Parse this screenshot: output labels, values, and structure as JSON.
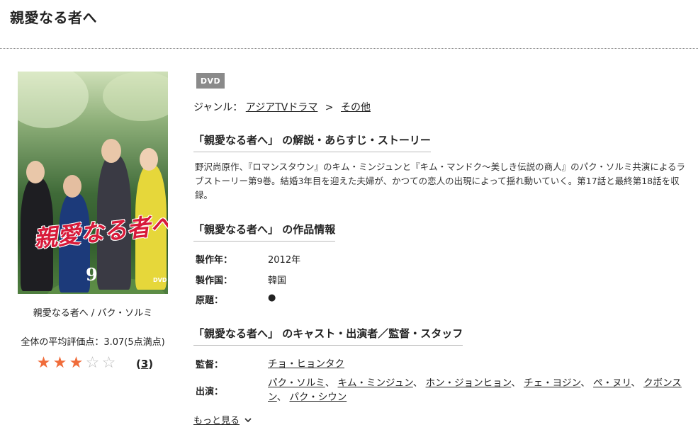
{
  "page": {
    "title": "親愛なる者へ"
  },
  "cover": {
    "logo_text": "親愛なる者へ",
    "volume": "9",
    "dvd_mark": "DVD"
  },
  "caption": "親愛なる者へ / パク・ソルミ",
  "rating": {
    "text": "全体の平均評価点：3.07(5点満点)",
    "score": 3.07,
    "max": 5,
    "stars_filled": 3,
    "review_count": "3",
    "review_open": "(",
    "review_close": ")",
    "star_color": "#f06c3a"
  },
  "badge": "DVD",
  "genre": {
    "label": "ジャンル：",
    "separator": ">",
    "links": [
      "アジアTVドラマ",
      "その他"
    ]
  },
  "synopsis": {
    "heading": "「親愛なる者へ」 の解説・あらすじ・ストーリー",
    "text": "野沢尚原作、『ロマンスタウン』のキム・ミンジュンと『キム・マンドク〜美しき伝説の商人』のパク・ソルミ共演によるラブストーリー第9巻。結婚3年目を迎えた夫婦が、かつての恋人の出現によって揺れ動いていく。第17話と最終第18話を収録。"
  },
  "info": {
    "heading": "「親愛なる者へ」 の作品情報",
    "rows": [
      {
        "label": "製作年：",
        "value": "2012年"
      },
      {
        "label": "製作国：",
        "value": "韓国"
      },
      {
        "label": "原題：",
        "value": "●"
      }
    ]
  },
  "cast": {
    "heading": "「親愛なる者へ」 のキャスト・出演者／監督・スタッフ",
    "director_label": "監督：",
    "director": "チョ・ヒョンタク",
    "actors_label": "出演：",
    "actor_separator": "、",
    "actors": [
      "パク・ソルミ",
      "キム・ミンジュン",
      "ホン・ジョンヒョン",
      "チェ・ヨジン",
      "ペ・ヌリ",
      "クボンスン",
      "パク・シウン"
    ]
  },
  "more_label": "もっと見る"
}
